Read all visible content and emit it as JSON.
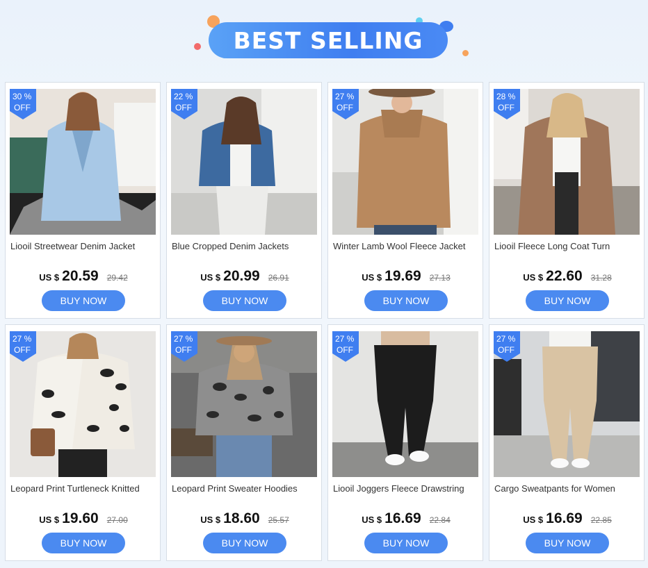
{
  "banner": {
    "title": "BEST SELLING"
  },
  "colors": {
    "accent": "#4b8af0",
    "badge": "#3f7ef0"
  },
  "products": [
    {
      "discount": "30 %",
      "off": "OFF",
      "name": "Liooil Streetwear Denim Jacket",
      "currency": "US $",
      "price": "20.59",
      "old_price": "29.42",
      "buy": "BUY NOW"
    },
    {
      "discount": "22 %",
      "off": "OFF",
      "name": "Blue Cropped Denim Jackets",
      "currency": "US $",
      "price": "20.99",
      "old_price": "26.91",
      "buy": "BUY NOW"
    },
    {
      "discount": "27 %",
      "off": "OFF",
      "name": "Winter Lamb Wool Fleece Jacket",
      "currency": "US $",
      "price": "19.69",
      "old_price": "27.13",
      "buy": "BUY NOW"
    },
    {
      "discount": "28 %",
      "off": "OFF",
      "name": "Liooil Fleece Long Coat Turn",
      "currency": "US $",
      "price": "22.60",
      "old_price": "31.28",
      "buy": "BUY NOW"
    },
    {
      "discount": "27 %",
      "off": "OFF",
      "name": "Leopard Print Turtleneck Knitted",
      "currency": "US $",
      "price": "19.60",
      "old_price": "27.00",
      "buy": "BUY NOW"
    },
    {
      "discount": "27 %",
      "off": "OFF",
      "name": "Leopard Print Sweater Hoodies",
      "currency": "US $",
      "price": "18.60",
      "old_price": "25.57",
      "buy": "BUY NOW"
    },
    {
      "discount": "27 %",
      "off": "OFF",
      "name": "Liooil Joggers Fleece Drawstring",
      "currency": "US $",
      "price": "16.69",
      "old_price": "22.84",
      "buy": "BUY NOW"
    },
    {
      "discount": "27 %",
      "off": "OFF",
      "name": "Cargo Sweatpants for Women",
      "currency": "US $",
      "price": "16.69",
      "old_price": "22.85",
      "buy": "BUY NOW"
    }
  ]
}
